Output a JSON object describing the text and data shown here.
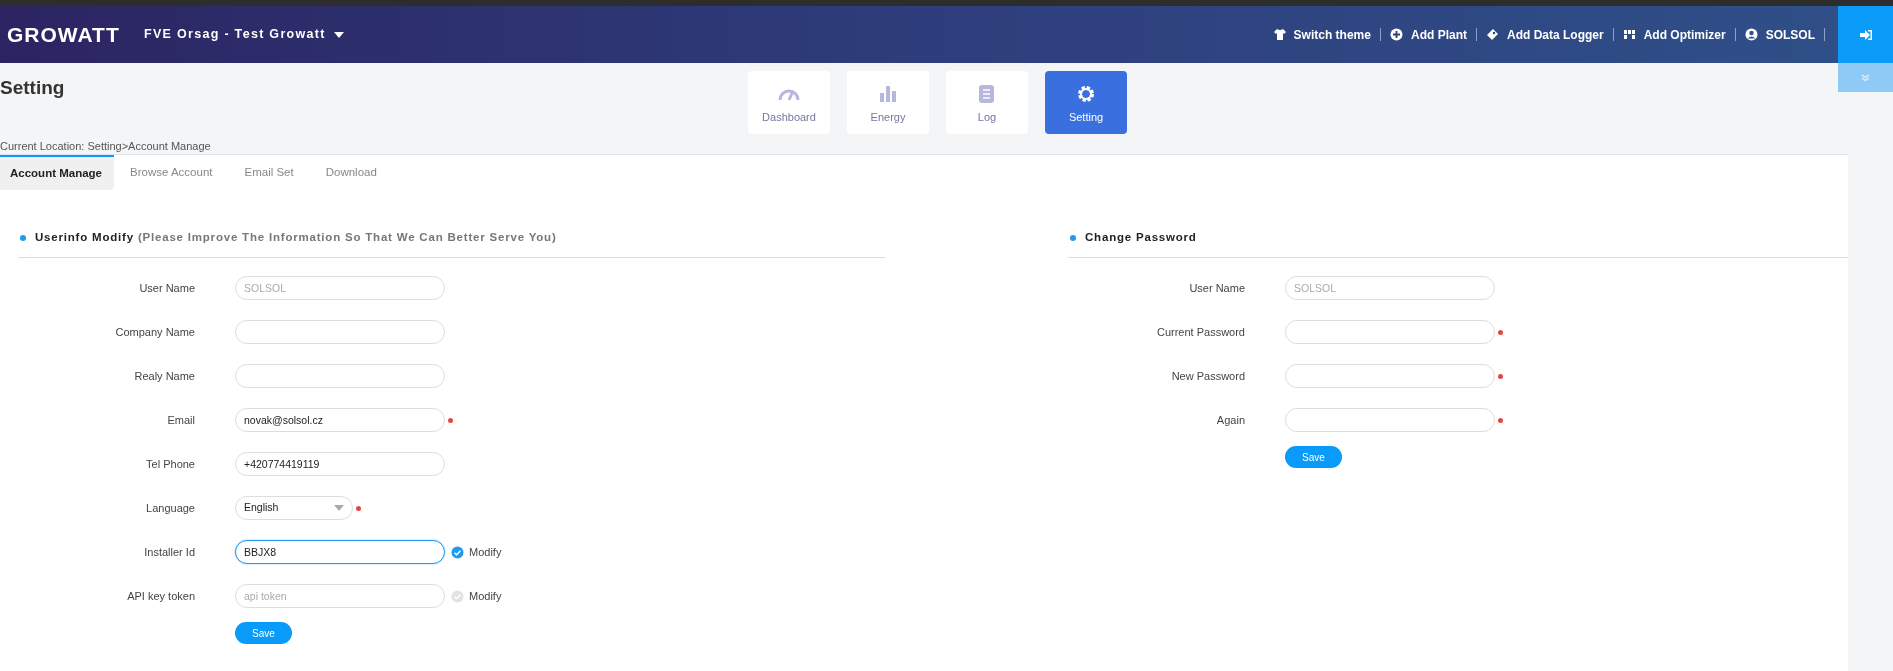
{
  "header": {
    "logo": "GROWATT",
    "plant_selector": "FVE Orsag - Test Growatt",
    "actions": [
      {
        "kind": "theme",
        "label": "Switch theme"
      },
      {
        "kind": "plant",
        "label": "Add Plant"
      },
      {
        "kind": "logger",
        "label": "Add Data Logger"
      },
      {
        "kind": "optimizer",
        "label": "Add Optimizer"
      },
      {
        "kind": "user",
        "label": "SOLSOL"
      }
    ]
  },
  "page_title": "Setting",
  "nav_tiles": [
    {
      "kind": "dashboard",
      "label": "Dashboard",
      "selected": false
    },
    {
      "kind": "energy",
      "label": "Energy",
      "selected": false
    },
    {
      "kind": "log",
      "label": "Log",
      "selected": false
    },
    {
      "kind": "setting",
      "label": "Setting",
      "selected": true
    }
  ],
  "breadcrumb": "Current Location: Setting>Account Manage",
  "tabs": [
    {
      "label": "Account Manage",
      "selected": true
    },
    {
      "label": "Browse Account",
      "selected": false
    },
    {
      "label": "Email Set",
      "selected": false
    },
    {
      "label": "Download",
      "selected": false
    }
  ],
  "userinfo": {
    "title": "Userinfo Modify",
    "subtitle": "(Please Improve The Information So That We Can Better Serve You)",
    "fields": [
      {
        "kind": "text",
        "label": "User Name",
        "placeholder": "SOLSOL",
        "required": false,
        "focused": false
      },
      {
        "kind": "text",
        "label": "Company Name",
        "required": false,
        "focused": false
      },
      {
        "kind": "text",
        "label": "Realy Name",
        "required": false,
        "focused": false
      },
      {
        "kind": "text",
        "label": "Email",
        "value": "novak@solsol.cz",
        "required": true,
        "focused": false
      },
      {
        "kind": "text",
        "label": "Tel Phone",
        "value": "+420774419119",
        "required": false,
        "focused": false
      },
      {
        "kind": "select",
        "label": "Language",
        "value": "English",
        "required": true,
        "focused": false
      },
      {
        "kind": "text",
        "label": "Installer Id",
        "value": "BBJX8",
        "required": false,
        "focused": true,
        "modify": {
          "label": "Modify",
          "checked": true
        }
      },
      {
        "kind": "text",
        "label": "API key token",
        "placeholder": "api token",
        "required": false,
        "focused": false,
        "modify": {
          "label": "Modify",
          "checked": false
        }
      }
    ],
    "save": "Save"
  },
  "password": {
    "title": "Change Password",
    "fields": [
      {
        "kind": "text",
        "label": "User Name",
        "placeholder": "SOLSOL",
        "required": false,
        "focused": false
      },
      {
        "kind": "text",
        "label": "Current Password",
        "required": true,
        "focused": false
      },
      {
        "kind": "text",
        "label": "New Password",
        "required": true,
        "focused": false
      },
      {
        "kind": "text",
        "label": "Again",
        "required": true,
        "focused": false
      }
    ],
    "save": "Save"
  }
}
